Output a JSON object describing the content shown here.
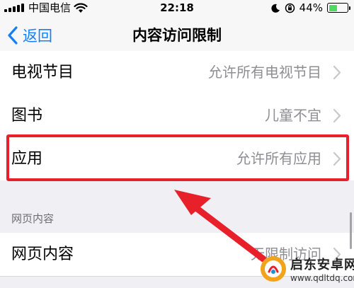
{
  "status_bar": {
    "carrier": "中国电信",
    "time": "22:18",
    "battery_percent": "44%",
    "battery_level": 0.44,
    "battery_color": "#4cd964"
  },
  "nav": {
    "back_label": "返回",
    "title": "内容访问限制"
  },
  "rows": [
    {
      "label": "电视节目",
      "value": "允许所有电视节目"
    },
    {
      "label": "图书",
      "value": "儿童不宜"
    },
    {
      "label": "应用",
      "value": "允许所有应用"
    }
  ],
  "section": {
    "header": "网页内容",
    "rows": [
      {
        "label": "网页内容",
        "value": "无限制访问"
      }
    ]
  },
  "annotation": {
    "highlight_color": "#e8202a"
  },
  "watermark": {
    "name": "启东安卓网",
    "url": "www.qdltdq.com"
  },
  "colors": {
    "accent": "#157efb",
    "secondary_text": "#8e8e93",
    "background": "#efeff4"
  }
}
